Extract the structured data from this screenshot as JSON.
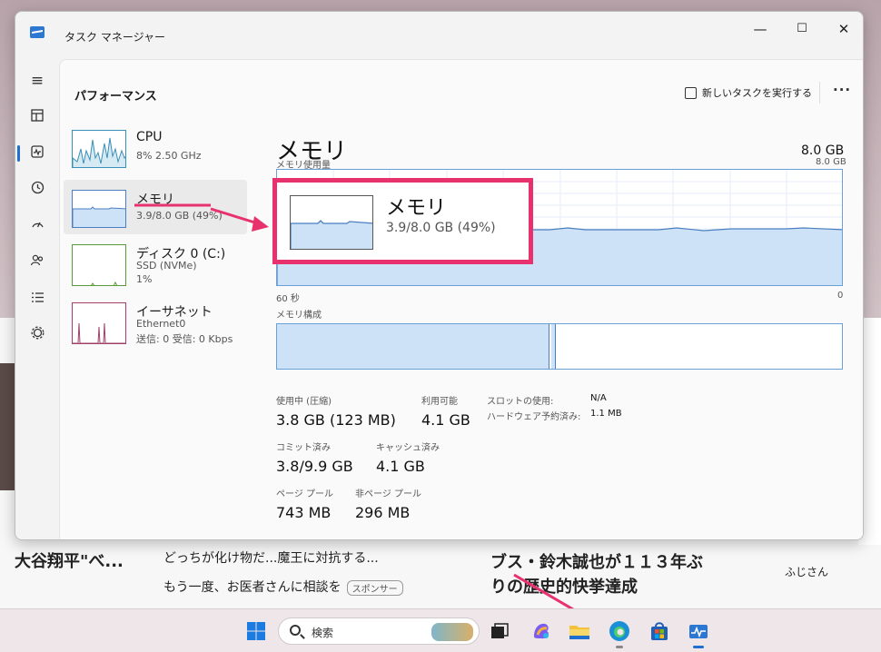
{
  "window": {
    "title": "タスク マネージャー",
    "controls": {
      "minimize": "—",
      "maximize": "☐",
      "close": "✕"
    }
  },
  "nav_icons": [
    "menu-icon",
    "processes-icon",
    "performance-icon",
    "app-history-icon",
    "startup-icon",
    "users-icon",
    "details-icon",
    "services-icon",
    "settings-icon"
  ],
  "header": {
    "page_title": "パフォーマンス",
    "new_task": "新しいタスクを実行する",
    "more": "···"
  },
  "sidebar": {
    "items": [
      {
        "name": "CPU",
        "sub1": "8%  2.50 GHz",
        "sub2": ""
      },
      {
        "name": "メモリ",
        "sub1": "3.9/8.0 GB (49%)",
        "sub2": ""
      },
      {
        "name": "ディスク 0 (C:)",
        "sub1": "SSD (NVMe)",
        "sub2": "1%"
      },
      {
        "name": "イーサネット",
        "sub1": "Ethernet0",
        "sub2": "送信: 0 受信: 0 Kbps"
      }
    ]
  },
  "main": {
    "title": "メモリ",
    "total": "8.0 GB",
    "usage_label": "メモリ使用量",
    "usage_max": "8.0 GB",
    "time_left": "60 秒",
    "time_right": "0",
    "composition_label": "メモリ構成",
    "usage_fraction": 0.49,
    "stats": {
      "in_use_label": "使用中 (圧縮)",
      "in_use": "3.8 GB (123 MB)",
      "available_label": "利用可能",
      "available": "4.1 GB",
      "committed_label": "コミット済み",
      "committed": "3.8/9.9 GB",
      "cached_label": "キャッシュ済み",
      "cached": "4.1 GB",
      "paged_label": "ページ プール",
      "paged": "743 MB",
      "nonpaged_label": "非ページ プール",
      "nonpaged": "296 MB",
      "slots_label": "スロットの使用:",
      "slots": "N/A",
      "reserved_label": "ハードウェア予約済み:",
      "reserved": "1.1 MB"
    }
  },
  "callout": {
    "name": "メモリ",
    "sub": "3.9/8.0 GB (49%)"
  },
  "background": {
    "headline_left": "大谷翔平\"べ...",
    "news1": "どっちが化け物だ...魔王に対抗する...",
    "news2": "もう一度、お医者さんに相談を",
    "sponsor": "スポンサー",
    "headline_right1": "ブス・鈴木誠也が１１３年ぶ",
    "headline_right2": "りの歴史的快挙達成",
    "source": "ふじさん"
  },
  "taskbar": {
    "search_placeholder": "検索",
    "icons": [
      "windows-start-icon",
      "search-icon",
      "task-view-icon",
      "copilot-icon",
      "file-explorer-icon",
      "edge-icon",
      "store-icon",
      "task-manager-icon"
    ]
  },
  "colors": {
    "accent_pink": "#e8326e",
    "graph_blue": "#6aa0d8",
    "fill_blue": "#cde1f7"
  }
}
